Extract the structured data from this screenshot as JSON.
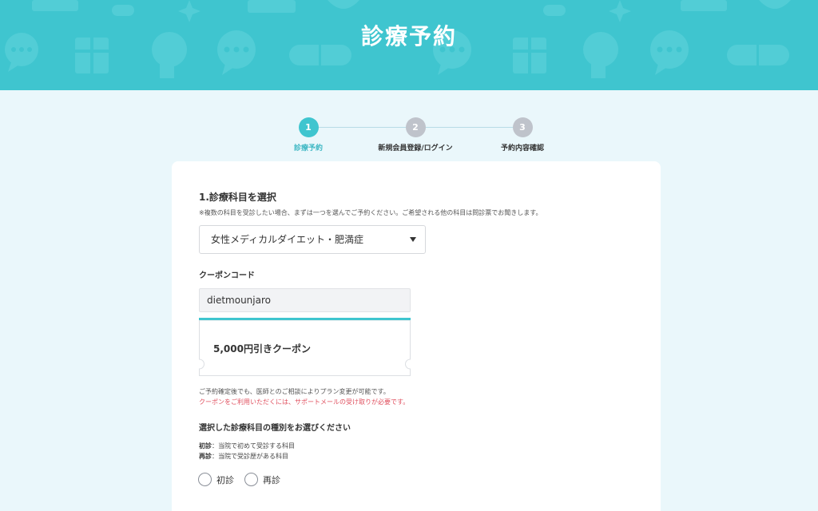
{
  "header": {
    "title": "診療予約"
  },
  "stepper": {
    "steps": [
      {
        "number": "1",
        "label": "診療予約",
        "state": "active"
      },
      {
        "number": "2",
        "label": "新規会員登録/ログイン",
        "state": "pending"
      },
      {
        "number": "3",
        "label": "予約内容確認",
        "state": "pending"
      }
    ]
  },
  "form": {
    "department": {
      "title": "1.診療科目を選択",
      "note": "※複数の科目を受診したい場合、まずは一つを選んでご予約ください。ご希望される他の科目は問診票でお聞きします。",
      "selected": "女性メディカルダイエット・肥満症"
    },
    "coupon": {
      "label": "クーポンコード",
      "value": "dietmounjaro",
      "result": "5,000円引きクーポン"
    },
    "notes": {
      "plan_change": "ご予約確定後でも、医師とのご相談によりプラン変更が可能です。",
      "coupon_warning": "クーポンをご利用いただくには、サポートメールの受け取りが必要です。"
    },
    "visit_type": {
      "title": "選択した診療科目の種別をお選びください",
      "first_term": "初診",
      "first_desc": "：当院で初めて受診する科目",
      "return_term": "再診",
      "return_desc": "：当院で受診歴がある科目",
      "options": [
        "初診",
        "再診"
      ]
    }
  },
  "colors": {
    "brand": "#3fc5cf",
    "background": "#eaf7fb",
    "step_inactive": "#bfc3cb",
    "warning": "#e0505f"
  }
}
